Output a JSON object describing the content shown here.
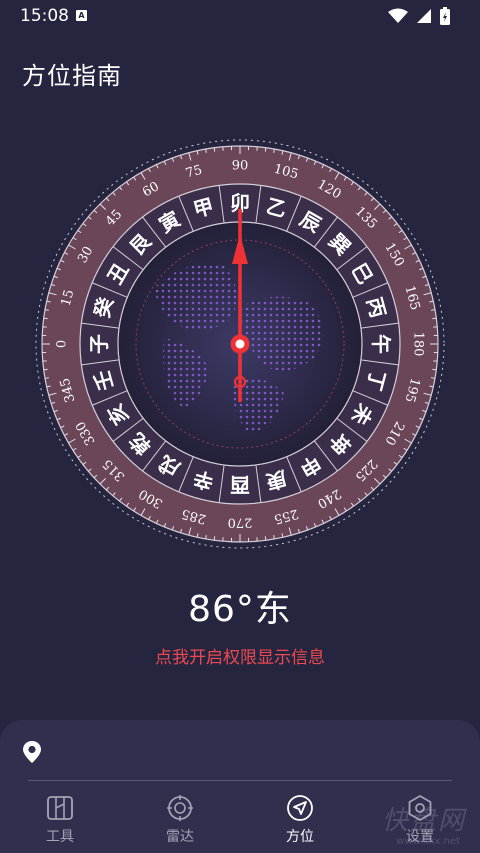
{
  "status_bar": {
    "time": "15:08",
    "notification_icon": "A"
  },
  "header": {
    "title": "方位指南"
  },
  "compass": {
    "heading_degrees": 86,
    "trigrams": [
      "卯",
      "乙",
      "辰",
      "巽",
      "巳",
      "丙",
      "午",
      "丁",
      "未",
      "坤",
      "申",
      "庚",
      "酉",
      "辛",
      "戌",
      "乾",
      "亥",
      "壬",
      "子",
      "癸",
      "丑",
      "艮",
      "寅",
      "甲"
    ],
    "degree_labels": [
      "90",
      "105",
      "120",
      "135",
      "150",
      "165",
      "180",
      "195",
      "210",
      "225",
      "240",
      "255",
      "270",
      "285",
      "300",
      "315",
      "330",
      "345",
      "0",
      "15",
      "30",
      "45",
      "60",
      "75"
    ],
    "colors": {
      "ring_outer": "#6a4658",
      "ring_inner": "#3a2e4a",
      "needle": "#ee3236",
      "map_dots": "#8e5ed8"
    }
  },
  "heading_text": "86°东",
  "permission_link": "点我开启权限显示信息",
  "location_card": {
    "icon": "location-pin-icon"
  },
  "bottom_nav": [
    {
      "label": "工具",
      "icon": "map-icon",
      "active": false
    },
    {
      "label": "雷达",
      "icon": "radar-icon",
      "active": false
    },
    {
      "label": "方位",
      "icon": "navigation-arrow-icon",
      "active": true
    },
    {
      "label": "设置",
      "icon": "settings-hex-icon",
      "active": false
    }
  ],
  "watermark": {
    "text": "快盘网",
    "sub": "www.kkx.net"
  }
}
